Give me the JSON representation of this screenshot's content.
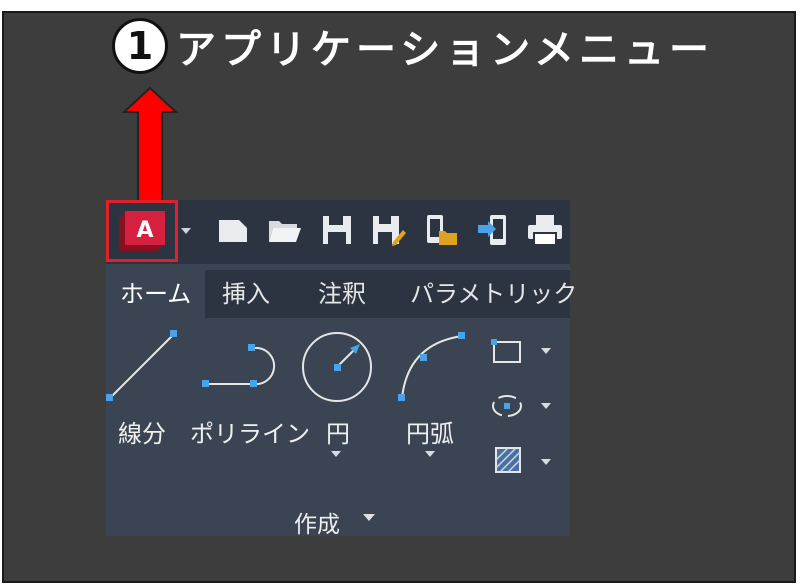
{
  "callout": {
    "number": "1",
    "title": "アプリケーションメニュー"
  },
  "toolbar": {
    "app_menu_letter": "A",
    "quick_access_icons": [
      "new-file-icon",
      "open-folder-icon",
      "save-icon",
      "save-as-icon",
      "open-from-mobile-icon",
      "publish-icon",
      "print-icon"
    ]
  },
  "ribbon": {
    "tabs": [
      "ホーム",
      "挿入",
      "注釈",
      "パラメトリック"
    ],
    "active_tab": "ホーム",
    "tools": {
      "line": "線分",
      "polyline": "ポリライン",
      "circle": "円",
      "arc": "円弧"
    },
    "panel_title": "作成"
  },
  "colors": {
    "background": "#3d3d3d",
    "panel": "#3b4453",
    "toolbar": "#2d3441",
    "highlight": "#e0202a",
    "arrow": "#ff0000",
    "accent_blue": "#4aa3e6"
  }
}
